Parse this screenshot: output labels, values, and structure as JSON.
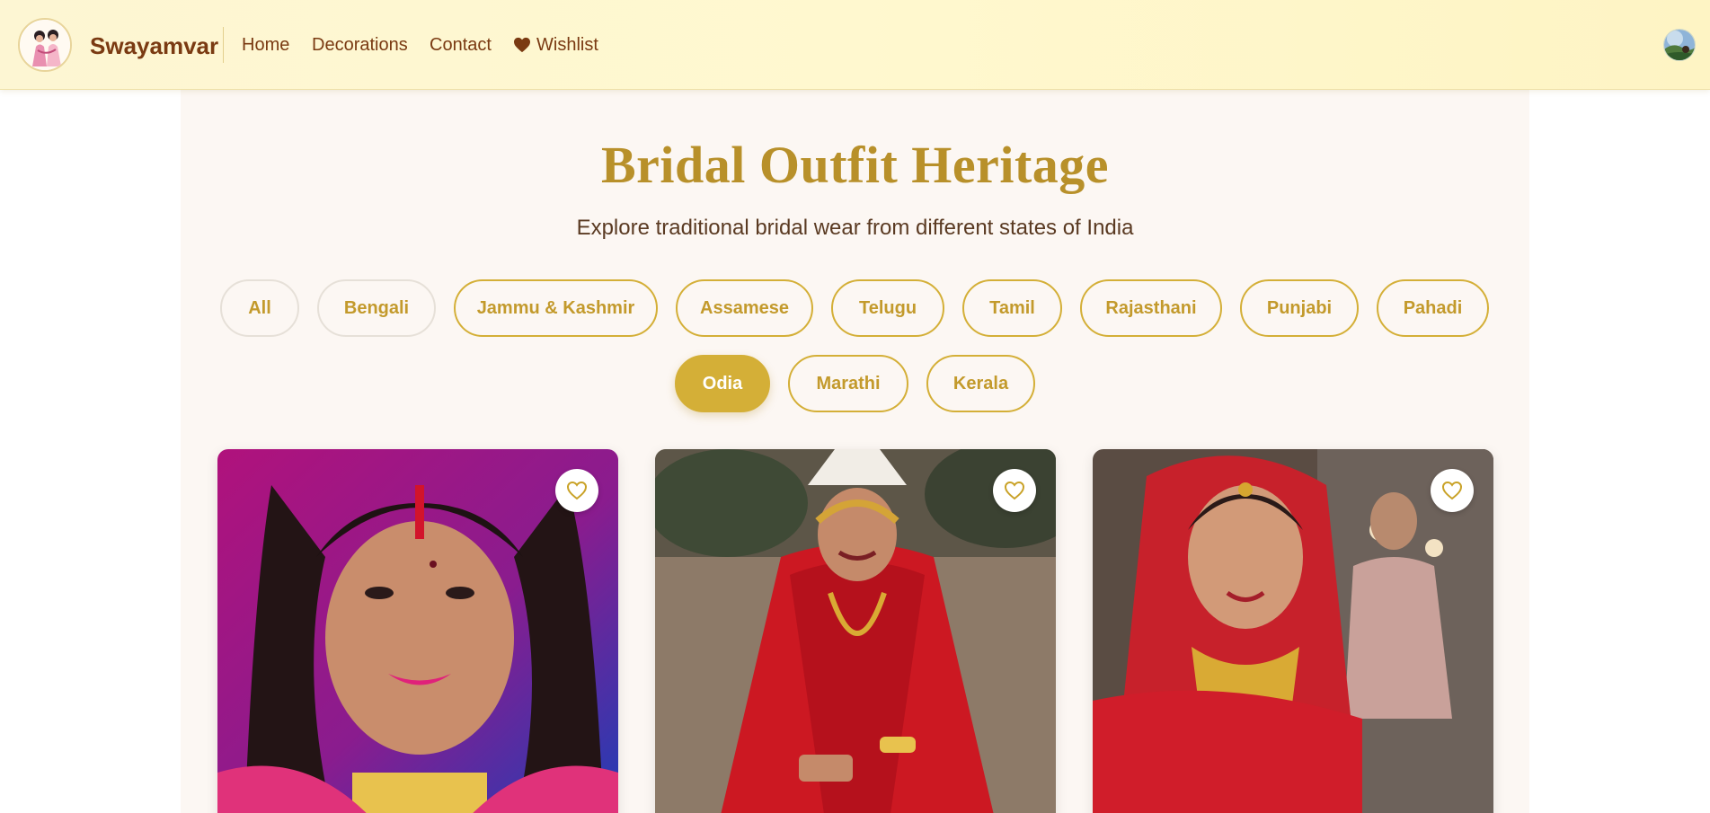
{
  "navbar": {
    "brand": "Swayamvar",
    "links": {
      "home": "Home",
      "decorations": "Decorations",
      "contact": "Contact",
      "wishlist": "Wishlist"
    },
    "wishlist_icon": "heart-icon"
  },
  "hero": {
    "title": "Bridal Outfit Heritage",
    "subtitle": "Explore traditional bridal wear from different states of India"
  },
  "filters": {
    "items": [
      "All",
      "Bengali",
      "Jammu & Kashmir",
      "Assamese",
      "Telugu",
      "Tamil",
      "Rajasthani",
      "Punjabi",
      "Pahadi",
      "Odia",
      "Marathi",
      "Kerala"
    ],
    "selected": "Odia"
  },
  "cards": [
    {
      "image": "bride-portrait-pink-saree",
      "favorite_icon": "heart-outline-icon"
    },
    {
      "image": "bride-red-saree-crown",
      "favorite_icon": "heart-outline-icon"
    },
    {
      "image": "bride-red-saree-jewelry",
      "favorite_icon": "heart-outline-icon"
    }
  ],
  "colors": {
    "accent_gold": "#d4af37",
    "title_gold": "#b8902a",
    "brand_brown": "#7a3a12",
    "nav_background": "#fff8cf",
    "panel_background": "#fcf7f3"
  }
}
